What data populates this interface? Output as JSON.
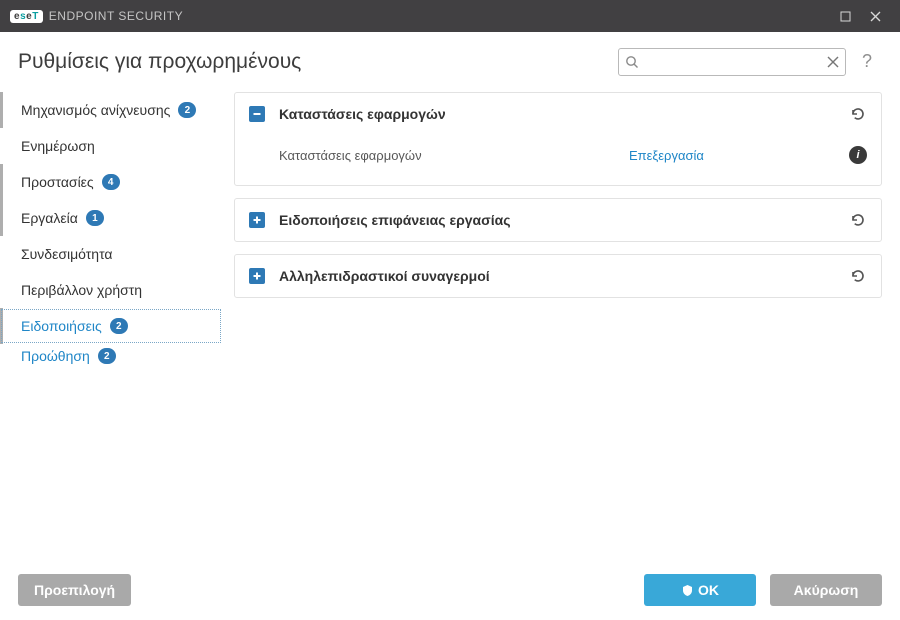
{
  "titlebar": {
    "brand": {
      "e1": "e",
      "s": "s",
      "e2": "e",
      "t": "T"
    },
    "product": "ENDPOINT SECURITY"
  },
  "header": {
    "title": "Ρυθμίσεις για προχωρημένους",
    "search_placeholder": "",
    "help_label": "?"
  },
  "sidebar": {
    "items": [
      {
        "label": "Μηχανισμός ανίχνευσης",
        "badge": "2",
        "marked": true
      },
      {
        "label": "Ενημέρωση",
        "badge": null,
        "marked": false
      },
      {
        "label": "Προστασίες",
        "badge": "4",
        "marked": true
      },
      {
        "label": "Εργαλεία",
        "badge": "1",
        "marked": true
      },
      {
        "label": "Συνδεσιμότητα",
        "badge": null,
        "marked": false
      },
      {
        "label": "Περιβάλλον χρήστη",
        "badge": null,
        "marked": false
      },
      {
        "label": "Ειδοποιήσεις",
        "badge": "2",
        "marked": true,
        "active": true
      }
    ],
    "sub": {
      "label": "Προώθηση",
      "badge": "2"
    }
  },
  "panels": [
    {
      "expanded": true,
      "title": "Καταστάσεις εφαρμογών",
      "rows": [
        {
          "label": "Καταστάσεις εφαρμογών",
          "link": "Επεξεργασία"
        }
      ]
    },
    {
      "expanded": false,
      "title": "Ειδοποιήσεις επιφάνειας εργασίας"
    },
    {
      "expanded": false,
      "title": "Αλληλεπιδραστικοί συναγερμοί"
    }
  ],
  "footer": {
    "default_label": "Προεπιλογή",
    "ok_label": "OK",
    "cancel_label": "Ακύρωση"
  }
}
